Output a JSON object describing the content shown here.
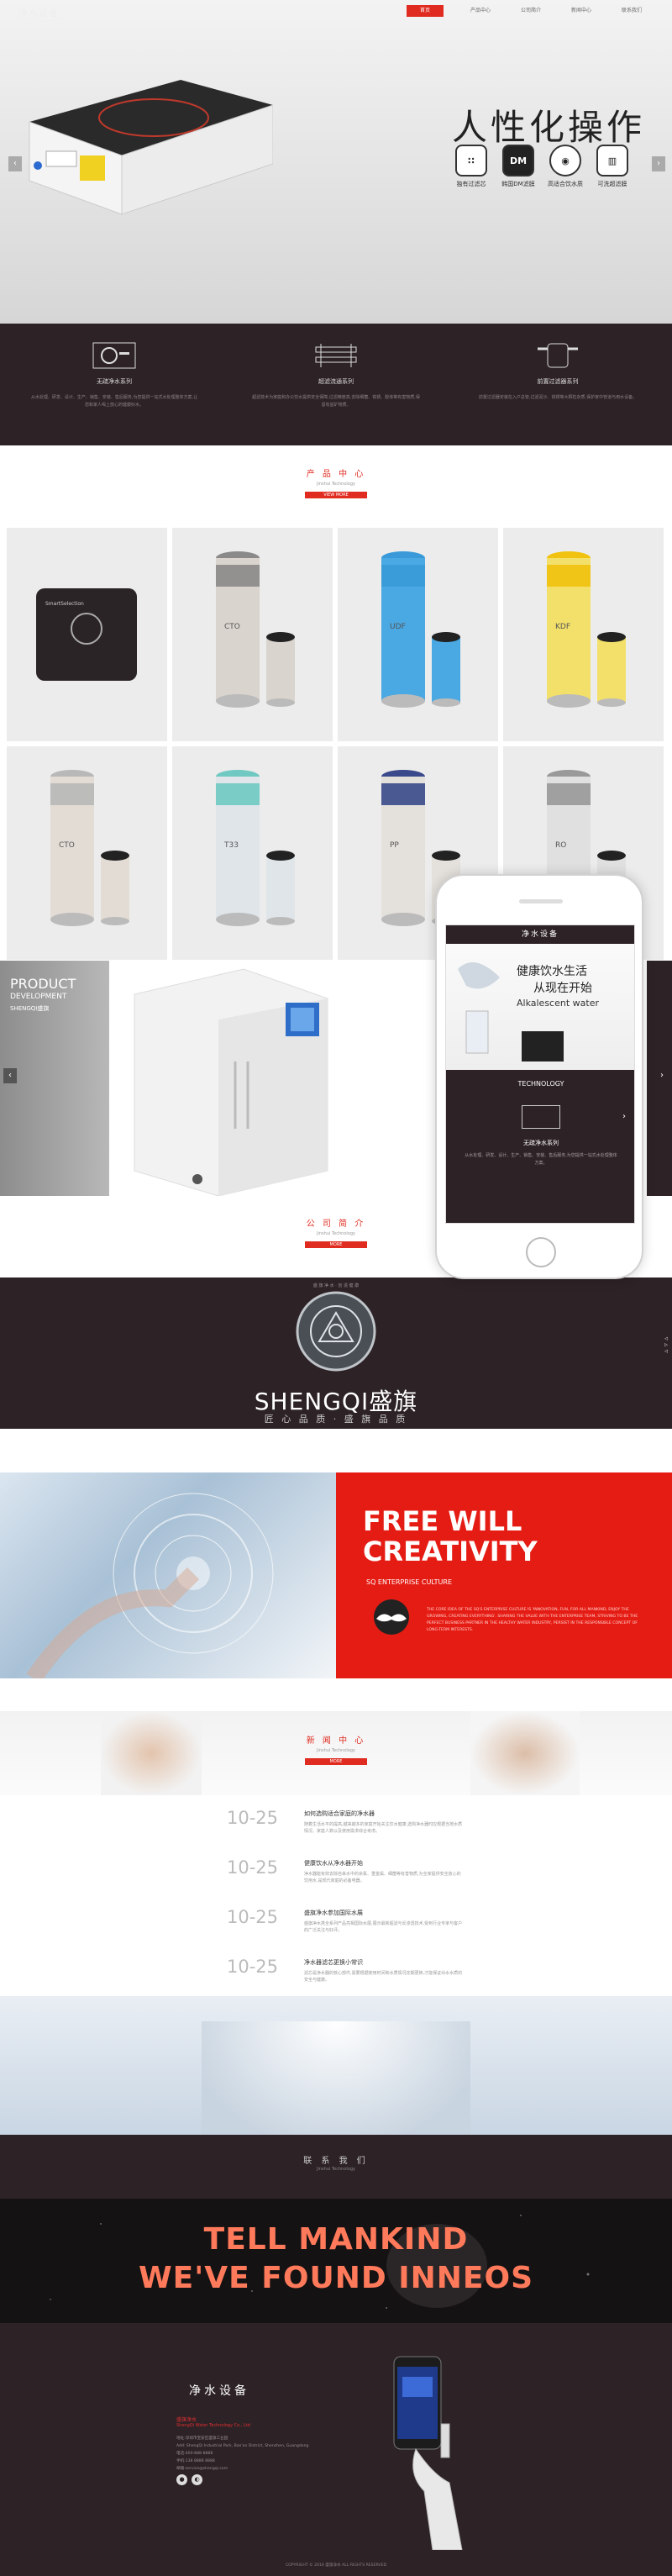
{
  "header": {
    "logo": "净水设备",
    "nav": [
      "首页",
      "产品中心",
      "公司简介",
      "新闻中心",
      "联系我们"
    ]
  },
  "hero": {
    "title": "人性化操作",
    "features": [
      {
        "icon": "filter-icon",
        "symbol": "∷",
        "label": "独有过滤芯"
      },
      {
        "icon": "dm-icon",
        "symbol": "DM",
        "label": "韩国DM滤膜"
      },
      {
        "icon": "water-drop-icon",
        "symbol": "◉",
        "label": "高适合饮水质"
      },
      {
        "icon": "ro-icon",
        "symbol": "▥",
        "label": "可洗超滤膜"
      }
    ],
    "prev": "‹",
    "next": "›"
  },
  "series": [
    {
      "title": "无疏净水系列",
      "desc": "从水处理、研发、设计、生产、销售、安装、售后服务,为您提供一站式水处理整体方案,让您和家人喝上放心的健康好水。"
    },
    {
      "title": "超滤流通系列",
      "desc": "超滤技术为家庭和办公饮水提供安全保障,过滤精度高,去除细菌、铁锈、胶体等有害物质,保留有益矿物质。"
    },
    {
      "title": "前置过滤器系列",
      "desc": "前置过滤器安装在入户总管,过滤泥沙、铁锈等大颗粒杂质,保护家中管道与用水设备。"
    }
  ],
  "products": {
    "title": "产 品 中 心",
    "subtitle": "Jinshui Technology",
    "button": "VIEW MORE",
    "items": [
      {
        "label": "SmartSelection",
        "cap": "#222222",
        "body": "#2b2426"
      },
      {
        "label": "CTO",
        "cap": "#8a8a8a",
        "body": "#d9d4cd"
      },
      {
        "label": "UDF",
        "cap": "#3a9ad9",
        "body": "#4aa8e2"
      },
      {
        "label": "KDF",
        "cap": "#f1c20f",
        "body": "#f3e06a"
      },
      {
        "label": "CTO",
        "cap": "#b8b8b8",
        "body": "#e2dcd5"
      },
      {
        "label": "T33",
        "cap": "#6fc9c2",
        "body": "#dfe5e8"
      },
      {
        "label": "PP",
        "cap": "#3a4a8a",
        "body": "#e4e0dc"
      },
      {
        "label": "RO",
        "cap": "#999999",
        "body": "#e0e0e0"
      }
    ]
  },
  "development": {
    "l1": "PRODUCT",
    "l2": "DEVELOPMENT",
    "l3": "SHENGQI盛旗"
  },
  "phone": {
    "logo": "净水设备",
    "headline1": "健康饮水生活",
    "headline2": "从现在开始",
    "headline3": "Alkalescent water",
    "section": "TECHNOLOGY",
    "series": "无疏净水系列",
    "desc": "从水处理、研发、设计、生产、销售、安装、售后服务,为您提供一站式水处理整体方案。"
  },
  "company": {
    "title": "公 司 简 介",
    "subtitle": "Jinshui Technology",
    "button": "MORE"
  },
  "brand": {
    "arc_text": "盛 旗 净 水 · 创 造 健 康",
    "name": "SHENGQI盛旗",
    "slogan": "匠 心 品 质 · 盛 旗 品 质"
  },
  "culture": {
    "title1": "FREE WILL",
    "title2": "CREATIVITY",
    "subtitle": "SQ ENTERPRISE CULTURE",
    "text": "THE CORE IDEA OF THE SQ'S ENTERPRISE CULTURE IS 'INNOVATION, FUN, FOR ALL MANKIND, ENJOY THE GROWING, CREATING EVERYTHING'. SHARING THE VALUE WITH THE ENTERPRISE TEAM, STRIVING TO BE THE PERFECT BUSINESS PARTNER IN THE HEALTHY WATER INDUSTRY, PERSIST IN THE RESPONSIBLE CONCEPT OF LONG-TERM INTERESTS."
  },
  "news": {
    "title": "新 闻 中 心",
    "subtitle": "Jinshui Technology",
    "button": "MORE",
    "items": [
      {
        "date": "10-25",
        "title": "如何选购适合家庭的净水器",
        "desc": "随着生活水平的提高,越来越多的家庭开始关注饮水健康,选购净水器时应根据当地水质情况、家庭人数以及使用需求综合考虑。"
      },
      {
        "date": "10-25",
        "title": "健康饮水从净水器开始",
        "desc": "净水器能有效去除自来水中的余氯、重金属、细菌等有害物质,为全家提供安全放心的饮用水,是现代家庭的必备电器。"
      },
      {
        "date": "10-25",
        "title": "盛旗净水参加国际水展",
        "desc": "盛旗净水携全系列产品亮相国际水展,展示最新超滤与反渗透技术,受到行业专家与客户的广泛关注与好评。"
      },
      {
        "date": "10-25",
        "title": "净水器滤芯更换小常识",
        "desc": "滤芯是净水器的核心部件,需要根据使用时间和水质情况定期更换,才能保证出水水质的安全与健康。"
      }
    ]
  },
  "contact": {
    "title": "联 系 我 们",
    "subtitle": "Jinshui Technology"
  },
  "tell": {
    "line1": "TELL MANKIND",
    "line2": "WE'VE FOUND INNEOS"
  },
  "footer": {
    "logo": "净水设备",
    "company": "盛旗净水",
    "company_en": "ShengQi Water Technology Co., Ltd",
    "info": [
      "地址:深圳市宝安区盛旗工业园",
      "Add: ShengQi Industrial Park, Bao'an District, Shenzhen, Guangdong",
      "电话:400-888-8888",
      "手机:138 8888 8888",
      "邮箱:service@shengqi.com"
    ],
    "copyright": "COPYRIGHT © 2016 盛旗净水 ALL RIGHTS RESERVED"
  },
  "colors": {
    "accent": "#e02b20",
    "dark": "#2d2226"
  }
}
